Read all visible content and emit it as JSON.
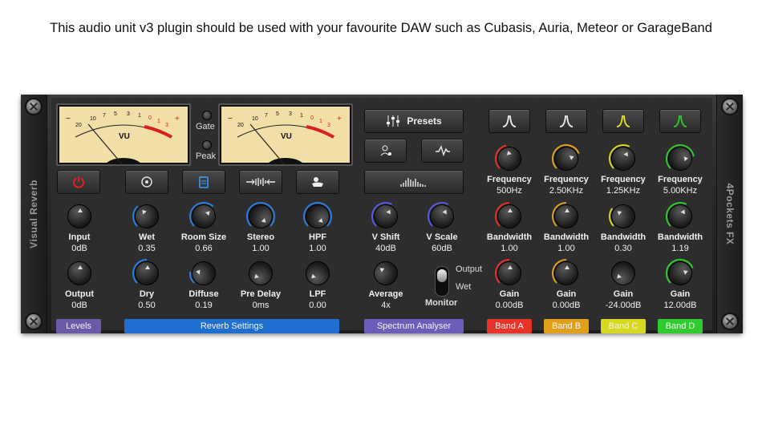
{
  "caption": "This audio unit v3 plugin should be used with your favourite DAW such as Cubasis, Auria, Meteor or GarageBand",
  "side_left": "Visual Reverb",
  "side_right": "4Pockets FX",
  "vu": {
    "label": "VU",
    "scale": [
      "20",
      "10",
      "7",
      "5",
      "3",
      "1",
      "0",
      "1",
      "3"
    ],
    "minus": "−",
    "plus": "+"
  },
  "indicators": {
    "gate": "Gate",
    "peak": "Peak"
  },
  "buttons": {
    "presets": "Presets"
  },
  "knobs": {
    "input": {
      "label": "Input",
      "value": "0dB",
      "level": 0.5
    },
    "output": {
      "label": "Output",
      "value": "0dB",
      "level": 0.5
    },
    "wet": {
      "label": "Wet",
      "value": "0.35",
      "level": 0.35
    },
    "dry": {
      "label": "Dry",
      "value": "0.50",
      "level": 0.5
    },
    "room_size": {
      "label": "Room Size",
      "value": "0.66",
      "level": 0.66
    },
    "diffuse": {
      "label": "Diffuse",
      "value": "0.19",
      "level": 0.19
    },
    "stereo": {
      "label": "Stereo",
      "value": "1.00",
      "level": 1.0
    },
    "pre_delay": {
      "label": "Pre Delay",
      "value": "0ms",
      "level": 0.0
    },
    "hpf": {
      "label": "HPF",
      "value": "1.00",
      "level": 1.0
    },
    "lpf": {
      "label": "LPF",
      "value": "0.00",
      "level": 0.0
    },
    "v_shift": {
      "label": "V Shift",
      "value": "40dB",
      "level": 0.6
    },
    "v_scale": {
      "label": "V Scale",
      "value": "60dB",
      "level": 0.6
    },
    "average": {
      "label": "Average",
      "value": "4x",
      "level": 0.3
    }
  },
  "monitor": {
    "label": "Monitor",
    "output": "Output",
    "wet": "Wet"
  },
  "bands": [
    {
      "name": "Band A",
      "color": "#e8332a",
      "frequency": "500Hz",
      "bandwidth": "1.00",
      "gain": "0.00dB"
    },
    {
      "name": "Band B",
      "color": "#e0a019",
      "frequency": "2.50KHz",
      "bandwidth": "1.00",
      "gain": "0.00dB"
    },
    {
      "name": "Band C",
      "color": "#d8d820",
      "frequency": "1.25KHz",
      "bandwidth": "0.30",
      "gain": "-24.00dB"
    },
    {
      "name": "Band D",
      "color": "#2ecc2e",
      "frequency": "5.00KHz",
      "bandwidth": "1.19",
      "gain": "12.00dB"
    }
  ],
  "band_labels": {
    "frequency": "Frequency",
    "bandwidth": "Bandwidth",
    "gain": "Gain"
  },
  "tabs": {
    "levels": "Levels",
    "reverb": "Reverb Settings",
    "spectrum": "Spectrum Analyser"
  },
  "colors": {
    "levels_tab": "#6a5aa8",
    "reverb_tab": "#1f6fd1",
    "spectrum_tab": "#6b5db8",
    "power": "#e02020",
    "blue_ring": "#2a7fe0",
    "purple_ring": "#5a5ae0"
  }
}
